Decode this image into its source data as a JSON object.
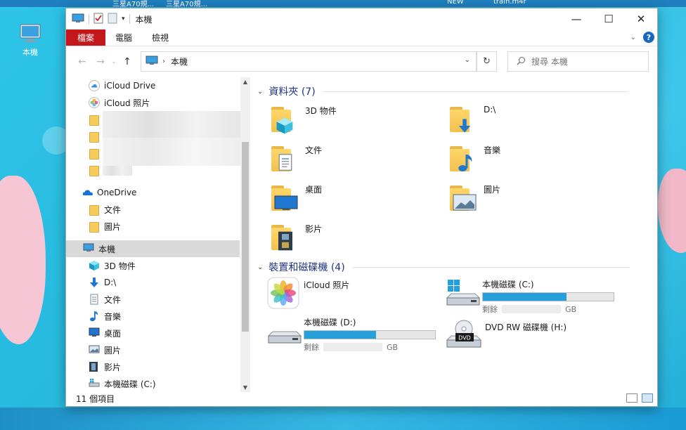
{
  "desktop": {
    "icon_label": "本機",
    "topbar_items": [
      "三星A70規...",
      "三星A70規...",
      "NEW",
      "train.m4r"
    ]
  },
  "window": {
    "title": "本機",
    "controls": {
      "minimize": "—",
      "maximize": "☐",
      "close": "✕"
    }
  },
  "ribbon": {
    "tabs": [
      "檔案",
      "電腦",
      "檢視"
    ],
    "help": "?"
  },
  "address": {
    "breadcrumb": "本機",
    "search_placeholder": "搜尋 本機"
  },
  "navpane": {
    "quick_access": [
      {
        "label": "iCloud Drive",
        "icon": "icloud-icon"
      },
      {
        "label": "iCloud 照片",
        "icon": "photos-icon"
      }
    ],
    "onedrive": {
      "label": "OneDrive",
      "children": [
        "文件",
        "圖片"
      ]
    },
    "this_pc": {
      "label": "本機",
      "children": [
        {
          "label": "3D 物件",
          "icon": "cube-icon"
        },
        {
          "label": "D:\\",
          "icon": "download-arrow-icon"
        },
        {
          "label": "文件",
          "icon": "document-icon"
        },
        {
          "label": "音樂",
          "icon": "music-note-icon"
        },
        {
          "label": "桌面",
          "icon": "desktop-icon"
        },
        {
          "label": "圖片",
          "icon": "picture-icon"
        },
        {
          "label": "影片",
          "icon": "film-icon"
        },
        {
          "label": "本機磁碟 (C:)",
          "icon": "drive-icon"
        }
      ]
    }
  },
  "content": {
    "folders_header": "資料夾 (7)",
    "folders": [
      {
        "label": "3D 物件",
        "icon": "cube-folder-icon"
      },
      {
        "label": "D:\\",
        "icon": "download-folder-icon"
      },
      {
        "label": "文件",
        "icon": "document-folder-icon"
      },
      {
        "label": "音樂",
        "icon": "music-folder-icon"
      },
      {
        "label": "桌面",
        "icon": "desktop-folder-icon"
      },
      {
        "label": "圖片",
        "icon": "picture-folder-icon"
      },
      {
        "label": "影片",
        "icon": "video-folder-icon"
      }
    ],
    "devices_header": "裝置和磁碟機 (4)",
    "devices": {
      "icloud": {
        "label": "iCloud 照片"
      },
      "c_drive": {
        "label": "本機磁碟 (C:)",
        "free_prefix": "剩餘",
        "unit": "GB",
        "used_fraction": 0.64
      },
      "d_drive": {
        "label": "本機磁碟 (D:)",
        "free_prefix": "剩餘",
        "unit": "GB",
        "used_fraction": 0.55
      },
      "dvd": {
        "label": "DVD RW 磁碟機 (H:)",
        "badge": "DVD"
      }
    }
  },
  "status": {
    "item_count": "11 個項目"
  },
  "colors": {
    "accent": "#26a0da",
    "file_tab": "#c4161c",
    "group_header": "#1e3287"
  }
}
